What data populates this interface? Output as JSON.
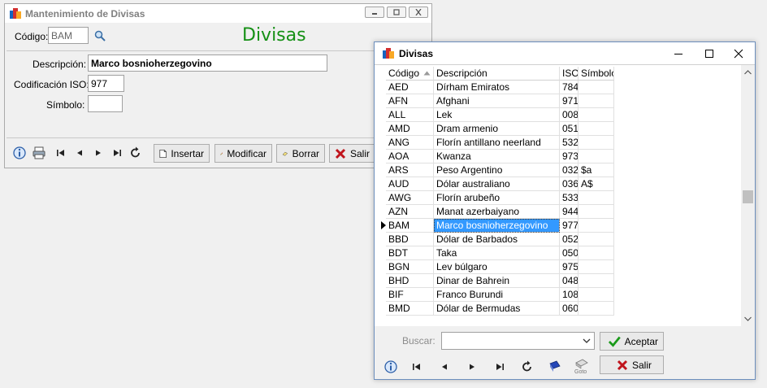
{
  "maint_window": {
    "title": "Mantenimiento de Divisas",
    "heading": "Divisas",
    "codigo_label": "Código:",
    "codigo_value": "BAM",
    "descripcion_label": "Descripción:",
    "descripcion_value": "Marco bosnioherzegovino",
    "iso_label": "Codificación ISO:",
    "iso_value": "977",
    "simbolo_label": "Símbolo:",
    "simbolo_value": "",
    "buttons": {
      "insertar": "Insertar",
      "modificar": "Modificar",
      "borrar": "Borrar",
      "salir": "Salir"
    }
  },
  "list_window": {
    "title": "Divisas",
    "columns": [
      "Código",
      "Descripción",
      "ISO",
      "Símbolo"
    ],
    "rows": [
      {
        "codigo": "AED",
        "descripcion": "Dírham Emiratos",
        "iso": "784",
        "simbolo": ""
      },
      {
        "codigo": "AFN",
        "descripcion": "Afghani",
        "iso": "971",
        "simbolo": ""
      },
      {
        "codigo": "ALL",
        "descripcion": "Lek",
        "iso": "008",
        "simbolo": ""
      },
      {
        "codigo": "AMD",
        "descripcion": "Dram armenio",
        "iso": "051",
        "simbolo": ""
      },
      {
        "codigo": "ANG",
        "descripcion": "Florín antillano neerland",
        "iso": "532",
        "simbolo": ""
      },
      {
        "codigo": "AOA",
        "descripcion": "Kwanza",
        "iso": "973",
        "simbolo": ""
      },
      {
        "codigo": "ARS",
        "descripcion": "Peso Argentino",
        "iso": "032",
        "simbolo": "$a"
      },
      {
        "codigo": "AUD",
        "descripcion": "Dólar australiano",
        "iso": "036",
        "simbolo": "A$"
      },
      {
        "codigo": "AWG",
        "descripcion": "Florín arubeño",
        "iso": "533",
        "simbolo": ""
      },
      {
        "codigo": "AZN",
        "descripcion": "Manat azerbaiyano",
        "iso": "944",
        "simbolo": ""
      },
      {
        "codigo": "BAM",
        "descripcion": "Marco bosnioherzegovino",
        "iso": "977",
        "simbolo": ""
      },
      {
        "codigo": "BBD",
        "descripcion": "Dólar de Barbados",
        "iso": "052",
        "simbolo": ""
      },
      {
        "codigo": "BDT",
        "descripcion": "Taka",
        "iso": "050",
        "simbolo": ""
      },
      {
        "codigo": "BGN",
        "descripcion": "Lev búlgaro",
        "iso": "975",
        "simbolo": ""
      },
      {
        "codigo": "BHD",
        "descripcion": "Dinar de Bahrein",
        "iso": "048",
        "simbolo": ""
      },
      {
        "codigo": "BIF",
        "descripcion": "Franco Burundi",
        "iso": "108",
        "simbolo": ""
      },
      {
        "codigo": "BMD",
        "descripcion": "Dólar de Bermudas",
        "iso": "060",
        "simbolo": ""
      }
    ],
    "selected_index": 10,
    "buscar_label": "Buscar:",
    "buscar_value": "",
    "aceptar_label": "Aceptar",
    "salir_label": "Salir",
    "goto_label": "Goto"
  },
  "colors": {
    "heading_green": "#159015",
    "selection_blue": "#3399ff",
    "ok_green": "#1a9a1a",
    "cancel_red": "#c0141c"
  }
}
